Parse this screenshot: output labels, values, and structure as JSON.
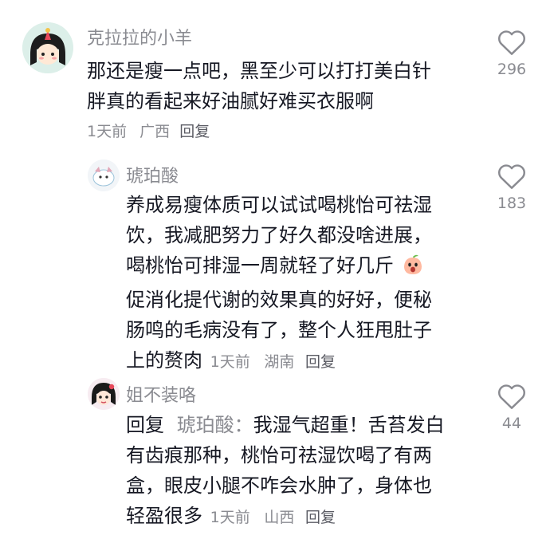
{
  "comments": [
    {
      "username": "克拉拉的小羊",
      "lines": [
        "那还是瘦一点吧，黑至少可以打打美白针",
        "胖真的看起来好油腻好难买衣服啊"
      ],
      "time": "1天前",
      "location": "广西",
      "reply_label": "回复",
      "likes": "296"
    },
    {
      "username": "琥珀酸",
      "lines": [
        "养成易瘦体质可以试试喝桃怡可祛湿",
        "饮，我减肥努力了好久都没啥进展，",
        "喝桃怡可排湿一周就轻了好几斤",
        "促消化提代谢的效果真的好好，便秘",
        "肠鸣的毛病没有了，整个人狂甩肚子",
        "上的赘肉"
      ],
      "emoji": "peach-face-emoji",
      "time": "1天前",
      "location": "湖南",
      "reply_label": "回复",
      "likes": "183"
    },
    {
      "username": "姐不装咯",
      "reply_prefix": "回复",
      "reply_to": "琥珀酸：",
      "lines": [
        "我湿气超重！舌苔发白",
        "有齿痕那种，桃怡可祛湿饮喝了有两",
        "盒，眼皮小腿不咋会水肿了，身体也",
        "轻盈很多"
      ],
      "time": "1天前",
      "location": "山西",
      "reply_label": "回复",
      "likes": "44"
    }
  ],
  "colors": {
    "primary_text": "#161823",
    "secondary_text": "#8a8b91",
    "heart_stroke": "#8a8b91"
  },
  "icons": {
    "like": "heart-outline-icon"
  }
}
